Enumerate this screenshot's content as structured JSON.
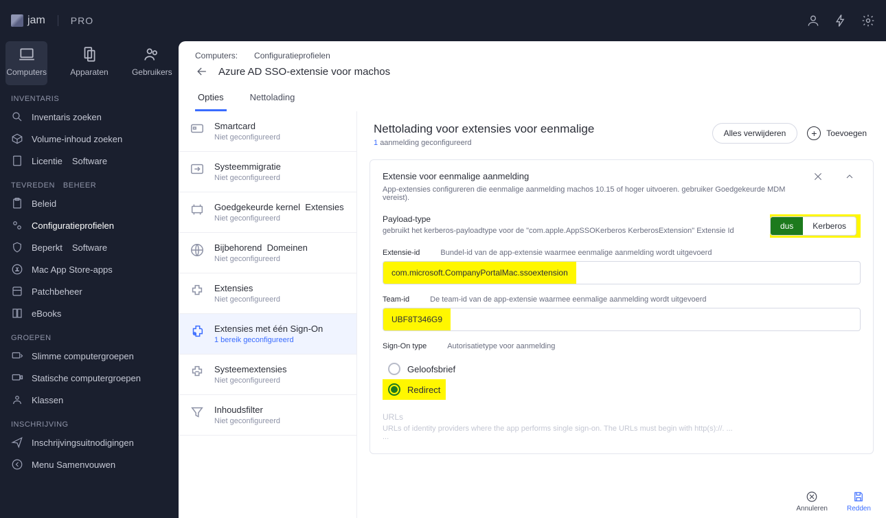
{
  "brand": {
    "name": "jam",
    "tier": "PRO"
  },
  "primary_tabs": {
    "computers": "Computers",
    "devices": "Apparaten",
    "users": "Gebruikers"
  },
  "sidebar": {
    "section_inventory": "INVENTARIS",
    "inv_search": "Inventaris zoeken",
    "vol_search": "Volume-inhoud zoeken",
    "licentie": "Licentie",
    "software1": "Software",
    "section_content1": "TEVREDEN",
    "section_content2": "BEHEER",
    "beleid": "Beleid",
    "config_profiles": "Configuratieprofielen",
    "beperkt": "Beperkt",
    "software2": "Software",
    "mas": "Mac App Store-apps",
    "patch": "Patchbeheer",
    "ebooks": "eBooks",
    "section_groups": "GROEPEN",
    "smart_groups": "Slimme computergroepen",
    "static_groups": "Statische computergroepen",
    "klassen": "Klassen",
    "section_enroll": "INSCHRIJVING",
    "invites": "Inschrijvingsuitnodigingen",
    "collapse": "Menu Samenvouwen"
  },
  "crumbs": {
    "a": "Computers:",
    "b": "Configuratieprofielen"
  },
  "page_title": "Azure AD SSO-extensie voor machos",
  "tabs": {
    "options": "Opties",
    "payload": "Nettolading"
  },
  "optlist": {
    "smartcard": {
      "title": "Smartcard",
      "sub": "Niet geconfigureerd"
    },
    "sysmig": {
      "title": "Systeemmigratie",
      "sub": "Niet geconfigureerd"
    },
    "kernel": {
      "title1": "Goedgekeurde kernel",
      "title2": "Extensies",
      "sub": "Niet geconfigureerd"
    },
    "assoc": {
      "title1": "Bijbehorend",
      "title2": "Domeinen",
      "sub": "Niet geconfigureerd"
    },
    "ext": {
      "title": "Extensies",
      "sub": "Niet geconfigureerd"
    },
    "sso": {
      "title": "Extensies met één Sign-On",
      "sub": "1 bereik geconfigureerd"
    },
    "sysext": {
      "title": "Systeemextensies",
      "sub": "Niet geconfigureerd"
    },
    "filter": {
      "title": "Inhoudsfilter",
      "sub": "Niet geconfigureerd"
    }
  },
  "rpane": {
    "title": "Nettolading voor extensies voor eenmalige",
    "sub_count": "1",
    "sub_text": "aanmelding geconfigureerd",
    "remove_all": "Alles verwijderen",
    "add": "Toevoegen",
    "card_title": "Extensie voor eenmalige aanmelding",
    "card_sub": "App-extensies configureren die eenmalige aanmelding machos 10.15 of hoger uitvoeren. gebruiker Goedgekeurde MDM vereist).",
    "payload_type": "Payload-type",
    "payload_hint": "gebruikt het kerberos-payloadtype voor de \"com.apple.AppSSOKerberos KerberosExtension\" Extensie Id",
    "seg_sso": "dus",
    "seg_krb": "Kerberos",
    "ext_id_label": "Extensie-id",
    "ext_id_hint": "Bundel-id van de app-extensie waarmee eenmalige aanmelding wordt uitgevoerd",
    "ext_id_value": "com.microsoft.CompanyPortalMac.ssoextension",
    "team_id_label": "Team-id",
    "team_id_hint": "De team-id van de app-extensie waarmee eenmalige aanmelding wordt uitgevoerd",
    "team_id_value": "UBF8T346G9",
    "signon_label": "Sign-On type",
    "signon_hint": "Autorisatietype voor aanmelding",
    "radio_cred": "Geloofsbrief",
    "radio_redirect": "Redirect",
    "urls_title": "URLs",
    "urls_body1": "URLs of identity providers where the app performs single sign-on. The URLs must begin with http(s)://. ...",
    "urls_body2": "...",
    "cancel": "Annuleren",
    "save": "Redden"
  }
}
